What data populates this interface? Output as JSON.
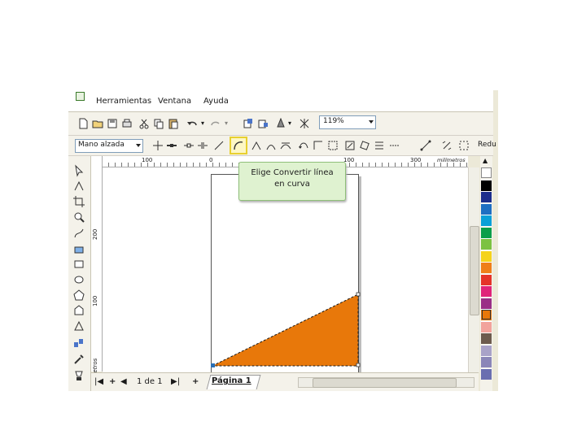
{
  "menu": {
    "items": [
      "Herramientas",
      "Ventana",
      "Ayuda"
    ]
  },
  "toolbar": {
    "zoom_value": "119%",
    "style_value": "Mano alzada",
    "overflow_label": "Redu"
  },
  "rulers": {
    "horizontal": [
      "100",
      "0",
      "100",
      "200",
      "300"
    ],
    "vertical": [
      "200",
      "100"
    ],
    "unit": "milímetros",
    "vertical_unit": "milímetros"
  },
  "callout": {
    "line1": "Elige Convertir línea",
    "line2": "en curva"
  },
  "shape": {
    "fill": "#e8780a",
    "outline": "#1a1a1a"
  },
  "navigator": {
    "page_count": "1 de 1",
    "tab_label": "Página 1"
  },
  "palette": [
    "#ffffff",
    "#000000",
    "#1d2e8c",
    "#1f6fc2",
    "#0aa0d8",
    "#0b9e4a",
    "#7cc242",
    "#f5d31b",
    "#ef7f1a",
    "#e5332a",
    "#e0247a",
    "#9a2f86",
    "#e8780a",
    "#f2a39c",
    "#6d5b4e",
    "#a9a2c8",
    "#8b86b8",
    "#6a6fb0"
  ]
}
